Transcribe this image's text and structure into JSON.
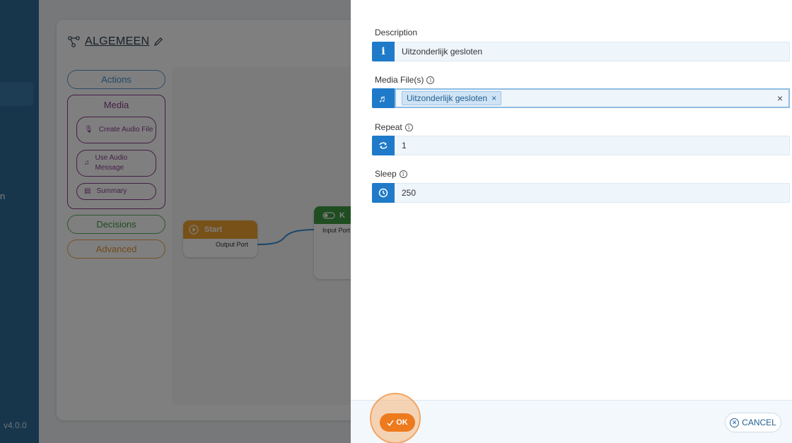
{
  "app": {
    "sidebar_letter": "n",
    "version": "v4.0.0"
  },
  "flow": {
    "title": "ALGEMEEN",
    "palette": {
      "actions": "Actions",
      "media_group": "Media",
      "media_items": [
        "Create Audio File",
        "Use Audio Message",
        "Summary"
      ],
      "decisions": "Decisions",
      "advanced": "Advanced"
    },
    "nodes": {
      "start_title": "Start",
      "start_port": "Output Port",
      "second_title": "K",
      "second_port": "Input Port"
    }
  },
  "panel": {
    "description": {
      "label": "Description",
      "value": "Uitzonderlijk gesloten"
    },
    "media": {
      "label": "Media File(s)",
      "chip": "Uitzonderlijk gesloten",
      "chip_remove": "×",
      "clear": "×"
    },
    "repeat": {
      "label": "Repeat",
      "value": "1"
    },
    "sleep": {
      "label": "Sleep",
      "value": "250"
    },
    "ok_label": "OK",
    "cancel_label": "CANCEL"
  },
  "colors": {
    "primary": "#1f7ac9",
    "ok": "#ee7a1e",
    "sidebar": "#2f6c99"
  }
}
